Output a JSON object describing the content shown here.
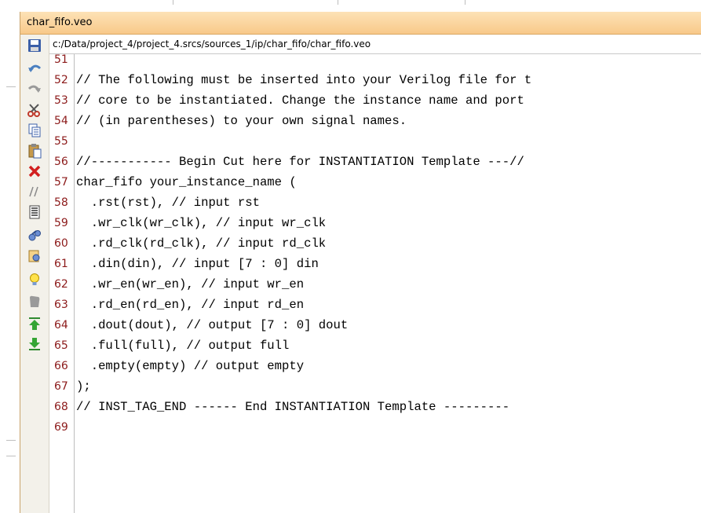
{
  "tab": {
    "title": "char_fifo.veo"
  },
  "file": {
    "path": "c:/Data/project_4/project_4.srcs/sources_1/ip/char_fifo/char_fifo.veo"
  },
  "toolbar": {
    "buttons": [
      {
        "icon": "save-icon"
      },
      {
        "icon": "undo-icon"
      },
      {
        "icon": "redo-icon"
      },
      {
        "icon": "cut-icon"
      },
      {
        "icon": "copy-icon"
      },
      {
        "icon": "paste-icon"
      },
      {
        "icon": "delete-icon"
      },
      {
        "icon": "comment-icon"
      },
      {
        "icon": "insert-template-icon"
      },
      {
        "icon": "find-icon"
      },
      {
        "icon": "find-in-files-icon"
      },
      {
        "icon": "bulb-icon"
      },
      {
        "icon": "bookmark-icon"
      },
      {
        "icon": "indent-up-icon"
      },
      {
        "icon": "indent-down-icon"
      }
    ]
  },
  "editor": {
    "lines": [
      {
        "num": "51",
        "text": ""
      },
      {
        "num": "52",
        "text": "// The following must be inserted into your Verilog file for t"
      },
      {
        "num": "53",
        "text": "// core to be instantiated. Change the instance name and port"
      },
      {
        "num": "54",
        "text": "// (in parentheses) to your own signal names."
      },
      {
        "num": "55",
        "text": ""
      },
      {
        "num": "56",
        "text": "//----------- Begin Cut here for INSTANTIATION Template ---//"
      },
      {
        "num": "57",
        "text": "char_fifo your_instance_name ("
      },
      {
        "num": "58",
        "text": "  .rst(rst), // input rst"
      },
      {
        "num": "59",
        "text": "  .wr_clk(wr_clk), // input wr_clk"
      },
      {
        "num": "60",
        "text": "  .rd_clk(rd_clk), // input rd_clk"
      },
      {
        "num": "61",
        "text": "  .din(din), // input [7 : 0] din"
      },
      {
        "num": "62",
        "text": "  .wr_en(wr_en), // input wr_en"
      },
      {
        "num": "63",
        "text": "  .rd_en(rd_en), // input rd_en"
      },
      {
        "num": "64",
        "text": "  .dout(dout), // output [7 : 0] dout"
      },
      {
        "num": "65",
        "text": "  .full(full), // output full"
      },
      {
        "num": "66",
        "text": "  .empty(empty) // output empty"
      },
      {
        "num": "67",
        "text": ");"
      },
      {
        "num": "68",
        "text": "// INST_TAG_END ------ End INSTANTIATION Template ---------"
      },
      {
        "num": "69",
        "text": ""
      }
    ]
  }
}
